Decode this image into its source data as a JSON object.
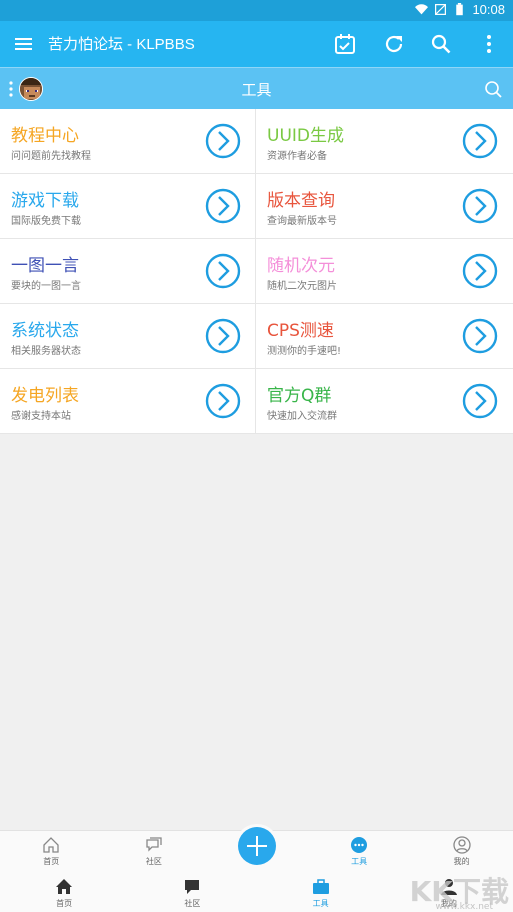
{
  "status": {
    "time": "10:08"
  },
  "appbar": {
    "title": "苦力怕论坛 - KLPBBS"
  },
  "subbar": {
    "title": "工具"
  },
  "tools": [
    {
      "name": "教程中心",
      "desc": "问问题前先找教程",
      "color": "#f5a623"
    },
    {
      "name": "UUID生成",
      "desc": "资源作者必备",
      "color": "#7ac943"
    },
    {
      "name": "游戏下载",
      "desc": "国际版免费下载",
      "color": "#29a8ec"
    },
    {
      "name": "版本查询",
      "desc": "查询最新版本号",
      "color": "#e8553d"
    },
    {
      "name": "一图一言",
      "desc": "要块的一图一言",
      "color": "#3f51b5"
    },
    {
      "name": "随机次元",
      "desc": "随机二次元图片",
      "color": "#f48fd9"
    },
    {
      "name": "系统状态",
      "desc": "相关服务器状态",
      "color": "#29a8ec"
    },
    {
      "name": "CPS测速",
      "desc": "测测你的手速吧!",
      "color": "#e8553d"
    },
    {
      "name": "发电列表",
      "desc": "感谢支持本站",
      "color": "#f5a623"
    },
    {
      "name": "官方Q群",
      "desc": "快速加入交流群",
      "color": "#39b54a"
    }
  ],
  "bottom_top": [
    {
      "label": "首页",
      "icon": "home-outline-icon"
    },
    {
      "label": "社区",
      "icon": "chat-outline-icon"
    },
    {
      "label": "",
      "icon": "add-icon"
    },
    {
      "label": "工具",
      "icon": "chat-dots-icon",
      "active": true
    },
    {
      "label": "我的",
      "icon": "user-outline-icon"
    }
  ],
  "bottom_bottom": [
    {
      "label": "首页",
      "icon": "home-icon"
    },
    {
      "label": "社区",
      "icon": "comment-icon"
    },
    {
      "label": "工具",
      "icon": "briefcase-icon",
      "active": true
    },
    {
      "label": "我的",
      "icon": "user-icon"
    }
  ],
  "watermark": {
    "text": "KK下载",
    "url": "www.kkx.net"
  },
  "colors": {
    "statusbar": "#1ea0d8",
    "appbar": "#26b5f1",
    "subbar": "#5bc2f3",
    "accent": "#1e9de0"
  }
}
